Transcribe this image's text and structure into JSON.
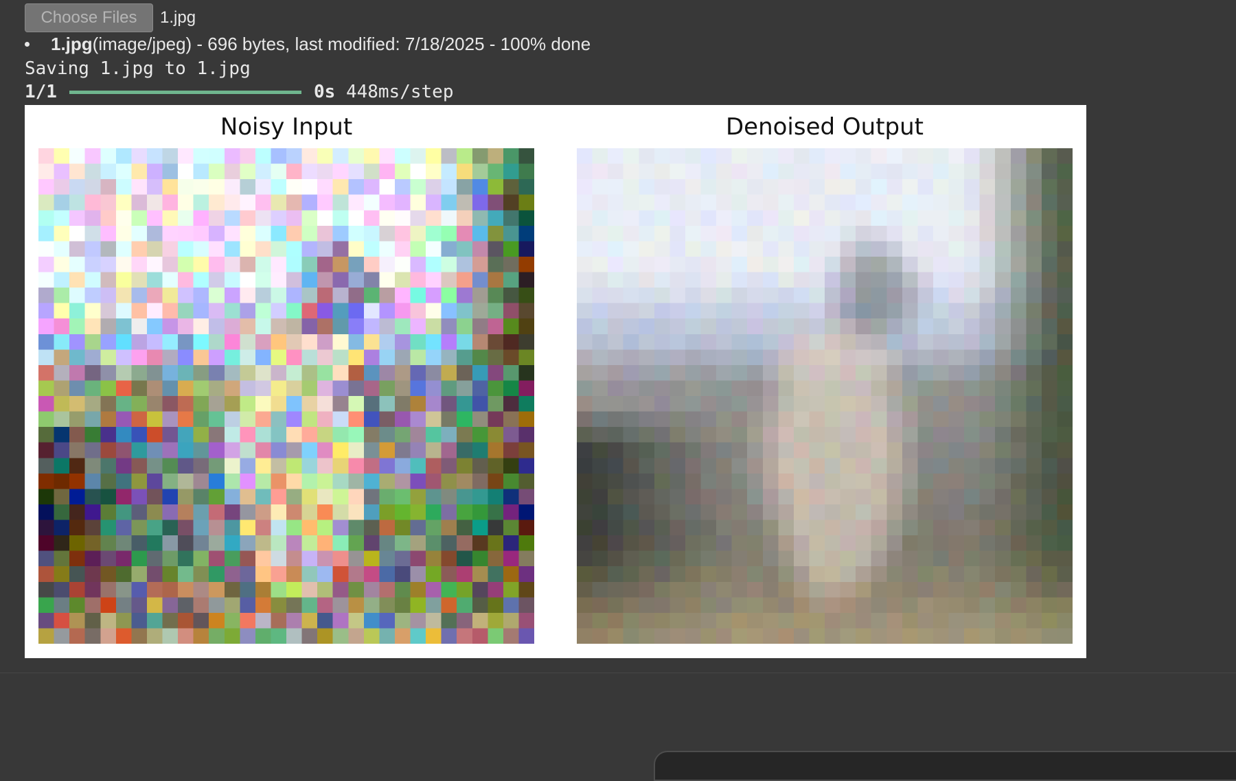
{
  "upload": {
    "choose_button_label": "Choose Files",
    "selected_file": "1.jpg",
    "files": [
      {
        "name": "1.jpg",
        "details": "(image/jpeg) - 696 bytes, last modified: 7/18/2025 - 100% done"
      }
    ]
  },
  "log": {
    "saving_line": "Saving 1.jpg to 1.jpg",
    "step_counter": "1/1",
    "progress_fraction": 1.0,
    "elapsed": "0s",
    "step_time": "448ms/step"
  },
  "figure": {
    "left_title": "Noisy Input",
    "right_title": "Denoised Output"
  },
  "colors": {
    "background": "#383838",
    "progress_bar": "#6fb58e",
    "button_bg": "#747474",
    "figure_bg": "#ffffff"
  }
}
